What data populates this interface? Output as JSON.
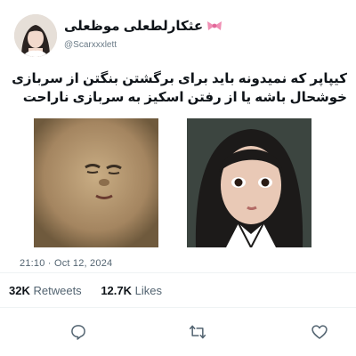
{
  "author": {
    "display_name": "عثکارلطعلی موظعلی",
    "handle": "@Scarxxxlett",
    "name_emoji": "bow-icon"
  },
  "tweet": {
    "text_lines": [
      "کیپاپر که نمیدونه باید برای برگشتن بنگتن از سربازی",
      "خوشحال باشه یا از رفتن اسکیز به سربازی ناراحت"
    ],
    "time": "21:10",
    "separator": "·",
    "date": "Oct 12, 2024"
  },
  "stats": {
    "retweets_count": "32K",
    "retweets_label": "Retweets",
    "likes_count": "12.7K",
    "likes_label": "Likes"
  },
  "actions": [
    "reply-icon",
    "retweet-icon",
    "like-icon"
  ],
  "colors": {
    "text": "#0f1419",
    "muted": "#536471",
    "bow": "#f08fb4",
    "divider": "#eff3f4"
  }
}
